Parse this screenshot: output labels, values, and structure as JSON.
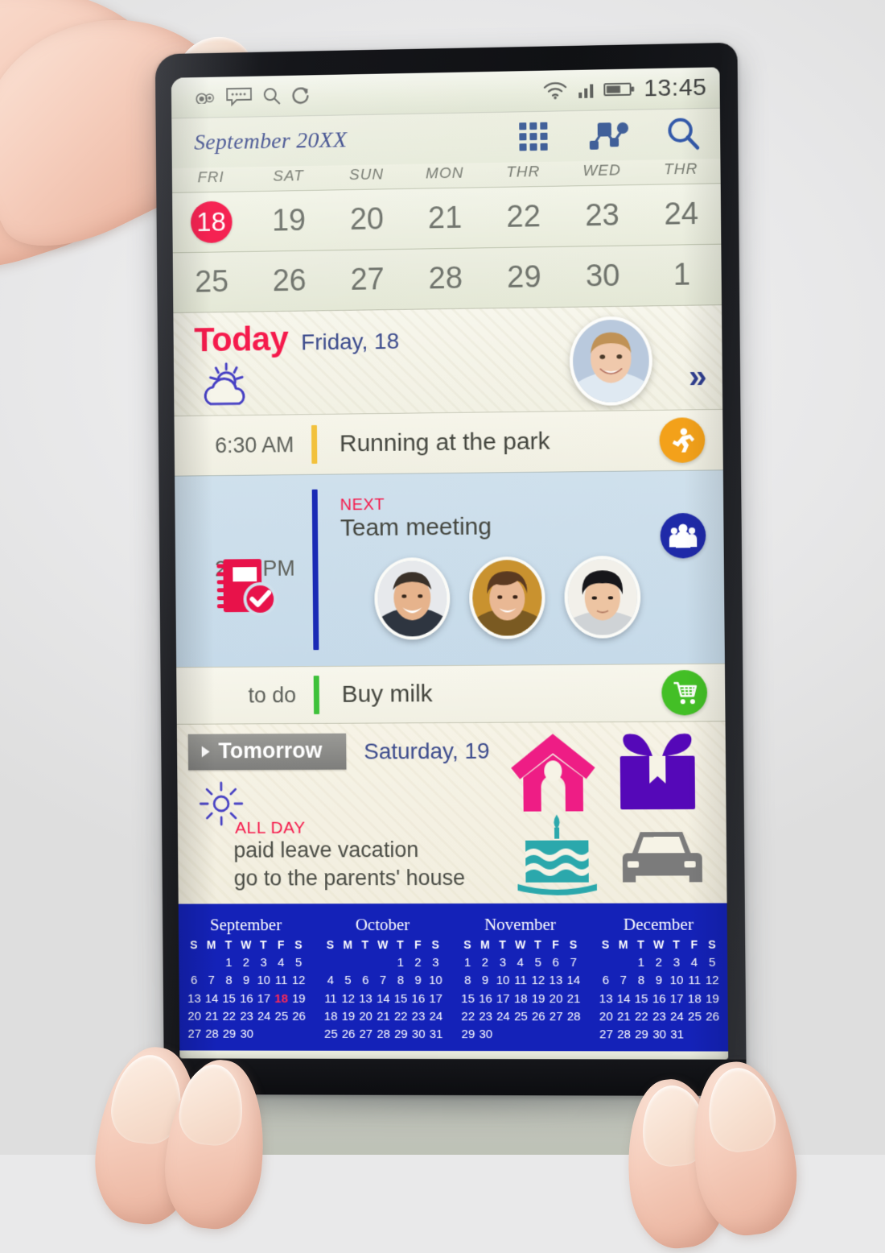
{
  "statusbar": {
    "icons_left": [
      "camera-icon",
      "mms-icon",
      "message-icon",
      "search-icon",
      "sync-icon"
    ],
    "icons_right": [
      "wifi-icon",
      "signal-icon",
      "battery-icon"
    ],
    "time": "13:45"
  },
  "header": {
    "month_title": "September 20XX",
    "actions": [
      {
        "name": "grid-view-button",
        "label": "grid"
      },
      {
        "name": "network-view-button",
        "label": "network"
      },
      {
        "name": "search-button",
        "label": "search"
      }
    ]
  },
  "week": {
    "dow": [
      "FRI",
      "SAT",
      "SUN",
      "MON",
      "THR",
      "WED",
      "THR"
    ],
    "row1": [
      "18",
      "19",
      "20",
      "21",
      "22",
      "23",
      "24"
    ],
    "row2": [
      "25",
      "26",
      "27",
      "28",
      "29",
      "30",
      "1"
    ],
    "today_index": 0
  },
  "today": {
    "label": "Today",
    "date": "Friday, 18",
    "weather_icon": "sun-behind-cloud-icon",
    "avatar": "user-avatar",
    "more_chevron": "»"
  },
  "events": [
    {
      "id": "running",
      "time": "6:30 AM",
      "kicker": "",
      "title": "Running at the park",
      "bar_color": "#f2c13c",
      "circle_color": "#f3a11a",
      "icon": "running-person-icon"
    },
    {
      "id": "meeting",
      "time": "2:00 PM",
      "kicker": "NEXT",
      "title": "Team meeting",
      "bar_color": "#1a2ab5",
      "circle_color": "#1f2aa8",
      "icon": "group-people-icon",
      "note_icon": "notebook-check-icon",
      "attendees": [
        "attendee-1",
        "attendee-2",
        "attendee-3"
      ]
    },
    {
      "id": "todo",
      "time": "to do",
      "kicker": "",
      "title": "Buy milk",
      "bar_color": "#3ec13a",
      "circle_color": "#43bf26",
      "icon": "shopping-cart-icon"
    }
  ],
  "tomorrow": {
    "badge": "Tomorrow",
    "date": "Saturday, 19",
    "weather_icon": "sun-icon",
    "allday_label": "ALL DAY",
    "items_line1": "paid leave vacation",
    "items_line2": "go to the parents' house",
    "icons": [
      {
        "name": "house-icon",
        "color": "#ee1d85"
      },
      {
        "name": "gift-icon",
        "color": "#5508b8"
      },
      {
        "name": "birthday-cake-icon",
        "color": "#2ba8ac"
      },
      {
        "name": "car-icon",
        "color": "#7b7b7b"
      }
    ]
  },
  "minicals": {
    "dow": [
      "S",
      "M",
      "T",
      "W",
      "T",
      "F",
      "S"
    ],
    "months": [
      {
        "title": "September",
        "start": 2,
        "days": 30,
        "highlight": 18
      },
      {
        "title": "October",
        "start": 4,
        "days": 31,
        "highlight": null
      },
      {
        "title": "November",
        "start": 0,
        "days": 30,
        "highlight": null
      },
      {
        "title": "December",
        "start": 2,
        "days": 31,
        "highlight": null
      }
    ]
  },
  "colors": {
    "accent_red": "#f5184a",
    "accent_blue": "#3b4a8c",
    "minical_bg": "#1422b8",
    "meeting_bg": "#cfe0ec"
  }
}
